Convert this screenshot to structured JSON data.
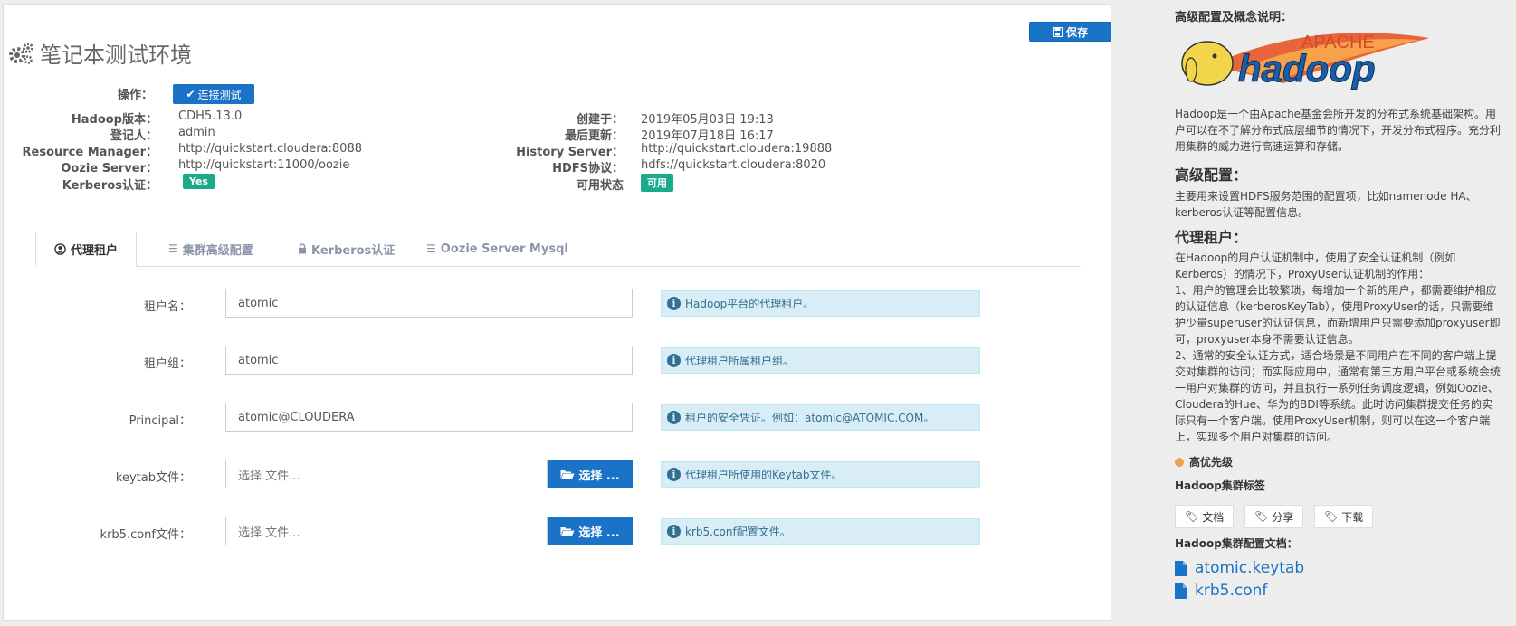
{
  "header": {
    "title": "笔记本测试环境",
    "save_label": "保存"
  },
  "operations": {
    "label": "操作：",
    "connect_label": "连接测试"
  },
  "info_left": [
    {
      "label": "Hadoop版本：",
      "value": "CDH5.13.0"
    },
    {
      "label": "登记人：",
      "value": "admin"
    },
    {
      "label": "Resource Manager：",
      "value": "http://quickstart.cloudera:8088"
    },
    {
      "label": "Oozie Server：",
      "value": "http://quickstart:11000/oozie"
    },
    {
      "label": "Kerberos认证：",
      "value": "Yes"
    }
  ],
  "info_right": [
    {
      "label": "创建于：",
      "value": "2019年05月03日 19:13"
    },
    {
      "label": "最后更新：",
      "value": "2019年07月18日 16:17"
    },
    {
      "label": "History Server：",
      "value": "http://quickstart.cloudera:19888"
    },
    {
      "label": "HDFS协议：",
      "value": "hdfs://quickstart.cloudera:8020"
    },
    {
      "label": "可用状态",
      "value": "可用"
    }
  ],
  "tabs": [
    {
      "label": "代理租户",
      "icon": "user-circle-icon"
    },
    {
      "label": "集群高级配置",
      "icon": "list-icon"
    },
    {
      "label": "Kerberos认证",
      "icon": "lock-icon"
    },
    {
      "label": "Oozie Server Mysql",
      "icon": "list-icon"
    }
  ],
  "form": {
    "tenant_name": {
      "label": "租户名：",
      "value": "atomic",
      "hint": "Hadoop平台的代理租户。"
    },
    "tenant_group": {
      "label": "租户组：",
      "value": "atomic",
      "hint": "代理租户所属租户组。"
    },
    "principal": {
      "label": "Principal：",
      "value": "atomic@CLOUDERA",
      "hint": "租户的安全凭证。例如：atomic@ATOMIC.COM。"
    },
    "keytab": {
      "label": "keytab文件：",
      "placeholder": "选择 文件...",
      "button": "选择 ...",
      "hint": "代理租户所使用的Keytab文件。"
    },
    "krb5": {
      "label": "krb5.conf文件：",
      "placeholder": "选择 文件...",
      "button": "选择 ...",
      "hint": "krb5.conf配置文件。"
    }
  },
  "sidebar": {
    "heading": "高级配置及概念说明：",
    "logo_text_top": "APACHE",
    "logo_text_main": "hadoop",
    "intro": "Hadoop是一个由Apache基金会所开发的分布式系统基础架构。用户可以在不了解分布式底层细节的情况下，开发分布式程序。充分利用集群的威力进行高速运算和存储。",
    "advanced_title": "高级配置：",
    "advanced_text": "主要用来设置HDFS服务范围的配置项，比如namenode HA、kerberos认证等配置信息。",
    "proxy_title": "代理租户：",
    "proxy_text": "在Hadoop的用户认证机制中，使用了安全认证机制（例如Kerberos）的情况下，ProxyUser认证机制的作用：\n1、用户的管理会比较繁琐，每增加一个新的用户，都需要维护相应的认证信息（kerberosKeyTab），使用ProxyUser的话，只需要维护少量superuser的认证信息，而新增用户只需要添加proxyuser即可，proxyuser本身不需要认证信息。\n2、通常的安全认证方式，适合场景是不同用户在不同的客户端上提交对集群的访问；而实际应用中，通常有第三方用户平台或系统会统一用户对集群的访问，并且执行一系列任务调度逻辑，例如Oozie、Cloudera的Hue、华为的BDI等系统。此时访问集群提交任务的实际只有一个客户端。使用ProxyUser机制，则可以在这一个客户端上，实现多个用户对集群的访问。",
    "priority": "高优先级",
    "tags_title": "Hadoop集群标签",
    "tags": [
      "文档",
      "分享",
      "下载"
    ],
    "docs_title": "Hadoop集群配置文档：",
    "docs": [
      "atomic.keytab",
      "krb5.conf"
    ]
  },
  "colors": {
    "primary": "#1a73c6",
    "success": "#1aab8a",
    "hint_bg": "#d9edf7",
    "priority": "#f0a24a"
  }
}
